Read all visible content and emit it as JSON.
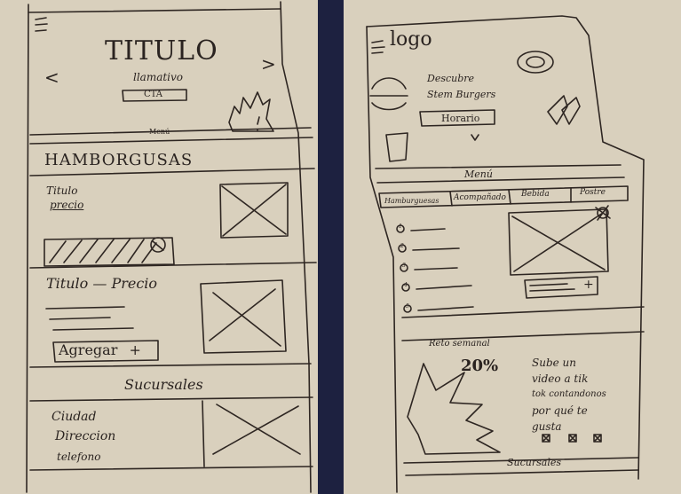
{
  "left_sketch": {
    "hero": {
      "title": "TITULO",
      "subtitle": "llamativo",
      "cta": "CTA",
      "prev_arrow": "<",
      "next_arrow": ">",
      "divider_label": "Menú"
    },
    "menu_category": "HAMBORGUSAS",
    "product_card": {
      "title": "Titulo",
      "price": "precio"
    },
    "product_row": {
      "title_price": "Titulo — Precio",
      "add_button": "Agregar",
      "add_icon": "+"
    },
    "branches": {
      "heading": "Sucursales",
      "city": "Ciudad",
      "address": "Direccion",
      "phone": "telefono"
    }
  },
  "right_sketch": {
    "header": {
      "logo": "logo",
      "tagline": "Descubre Stem Burgers",
      "hours_button": "Horario"
    },
    "menu": {
      "title": "Menú",
      "tabs": [
        "Hamburguesas",
        "Acompañado",
        "Bebida",
        "Postre"
      ],
      "list_numbers": [
        "1",
        "2",
        "3",
        "4",
        "5"
      ],
      "add_icon": "+"
    },
    "challenge": {
      "label": "Reto semanal",
      "discount": "20%",
      "description_lines": [
        "Sube un",
        "video a tik",
        "tok contandonos",
        "por qué te",
        "gusta"
      ]
    },
    "footer": {
      "branches": "Sucursales"
    }
  }
}
